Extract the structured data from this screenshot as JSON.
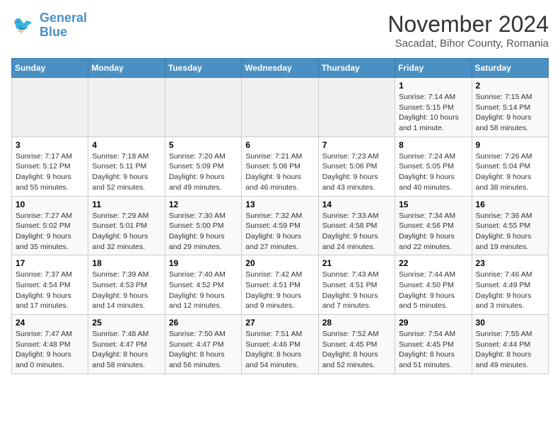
{
  "logo": {
    "line1": "General",
    "line2": "Blue"
  },
  "title": "November 2024",
  "subtitle": "Sacadat, Bihor County, Romania",
  "weekdays": [
    "Sunday",
    "Monday",
    "Tuesday",
    "Wednesday",
    "Thursday",
    "Friday",
    "Saturday"
  ],
  "weeks": [
    [
      {
        "day": "",
        "info": ""
      },
      {
        "day": "",
        "info": ""
      },
      {
        "day": "",
        "info": ""
      },
      {
        "day": "",
        "info": ""
      },
      {
        "day": "",
        "info": ""
      },
      {
        "day": "1",
        "info": "Sunrise: 7:14 AM\nSunset: 5:15 PM\nDaylight: 10 hours and 1 minute."
      },
      {
        "day": "2",
        "info": "Sunrise: 7:15 AM\nSunset: 5:14 PM\nDaylight: 9 hours and 58 minutes."
      }
    ],
    [
      {
        "day": "3",
        "info": "Sunrise: 7:17 AM\nSunset: 5:12 PM\nDaylight: 9 hours and 55 minutes."
      },
      {
        "day": "4",
        "info": "Sunrise: 7:18 AM\nSunset: 5:11 PM\nDaylight: 9 hours and 52 minutes."
      },
      {
        "day": "5",
        "info": "Sunrise: 7:20 AM\nSunset: 5:09 PM\nDaylight: 9 hours and 49 minutes."
      },
      {
        "day": "6",
        "info": "Sunrise: 7:21 AM\nSunset: 5:08 PM\nDaylight: 9 hours and 46 minutes."
      },
      {
        "day": "7",
        "info": "Sunrise: 7:23 AM\nSunset: 5:06 PM\nDaylight: 9 hours and 43 minutes."
      },
      {
        "day": "8",
        "info": "Sunrise: 7:24 AM\nSunset: 5:05 PM\nDaylight: 9 hours and 40 minutes."
      },
      {
        "day": "9",
        "info": "Sunrise: 7:26 AM\nSunset: 5:04 PM\nDaylight: 9 hours and 38 minutes."
      }
    ],
    [
      {
        "day": "10",
        "info": "Sunrise: 7:27 AM\nSunset: 5:02 PM\nDaylight: 9 hours and 35 minutes."
      },
      {
        "day": "11",
        "info": "Sunrise: 7:29 AM\nSunset: 5:01 PM\nDaylight: 9 hours and 32 minutes."
      },
      {
        "day": "12",
        "info": "Sunrise: 7:30 AM\nSunset: 5:00 PM\nDaylight: 9 hours and 29 minutes."
      },
      {
        "day": "13",
        "info": "Sunrise: 7:32 AM\nSunset: 4:59 PM\nDaylight: 9 hours and 27 minutes."
      },
      {
        "day": "14",
        "info": "Sunrise: 7:33 AM\nSunset: 4:58 PM\nDaylight: 9 hours and 24 minutes."
      },
      {
        "day": "15",
        "info": "Sunrise: 7:34 AM\nSunset: 4:56 PM\nDaylight: 9 hours and 22 minutes."
      },
      {
        "day": "16",
        "info": "Sunrise: 7:36 AM\nSunset: 4:55 PM\nDaylight: 9 hours and 19 minutes."
      }
    ],
    [
      {
        "day": "17",
        "info": "Sunrise: 7:37 AM\nSunset: 4:54 PM\nDaylight: 9 hours and 17 minutes."
      },
      {
        "day": "18",
        "info": "Sunrise: 7:39 AM\nSunset: 4:53 PM\nDaylight: 9 hours and 14 minutes."
      },
      {
        "day": "19",
        "info": "Sunrise: 7:40 AM\nSunset: 4:52 PM\nDaylight: 9 hours and 12 minutes."
      },
      {
        "day": "20",
        "info": "Sunrise: 7:42 AM\nSunset: 4:51 PM\nDaylight: 9 hours and 9 minutes."
      },
      {
        "day": "21",
        "info": "Sunrise: 7:43 AM\nSunset: 4:51 PM\nDaylight: 9 hours and 7 minutes."
      },
      {
        "day": "22",
        "info": "Sunrise: 7:44 AM\nSunset: 4:50 PM\nDaylight: 9 hours and 5 minutes."
      },
      {
        "day": "23",
        "info": "Sunrise: 7:46 AM\nSunset: 4:49 PM\nDaylight: 9 hours and 3 minutes."
      }
    ],
    [
      {
        "day": "24",
        "info": "Sunrise: 7:47 AM\nSunset: 4:48 PM\nDaylight: 9 hours and 0 minutes."
      },
      {
        "day": "25",
        "info": "Sunrise: 7:48 AM\nSunset: 4:47 PM\nDaylight: 8 hours and 58 minutes."
      },
      {
        "day": "26",
        "info": "Sunrise: 7:50 AM\nSunset: 4:47 PM\nDaylight: 8 hours and 56 minutes."
      },
      {
        "day": "27",
        "info": "Sunrise: 7:51 AM\nSunset: 4:46 PM\nDaylight: 8 hours and 54 minutes."
      },
      {
        "day": "28",
        "info": "Sunrise: 7:52 AM\nSunset: 4:45 PM\nDaylight: 8 hours and 52 minutes."
      },
      {
        "day": "29",
        "info": "Sunrise: 7:54 AM\nSunset: 4:45 PM\nDaylight: 8 hours and 51 minutes."
      },
      {
        "day": "30",
        "info": "Sunrise: 7:55 AM\nSunset: 4:44 PM\nDaylight: 8 hours and 49 minutes."
      }
    ]
  ]
}
